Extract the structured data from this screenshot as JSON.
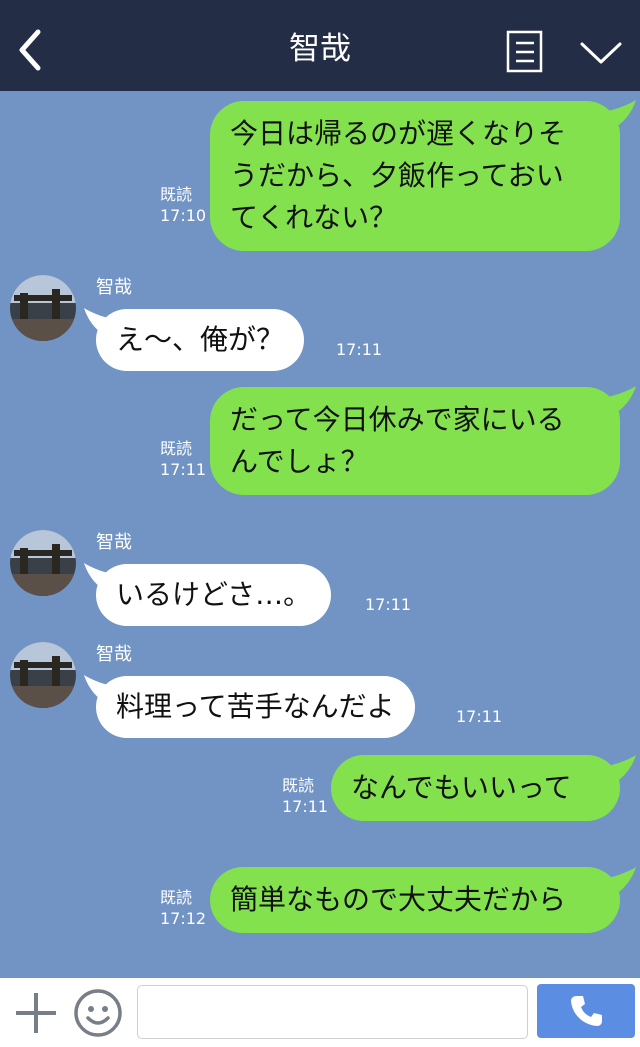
{
  "header": {
    "title": "智哉",
    "back_icon": "chevron-left-icon",
    "notes_icon": "notes-icon",
    "menu_icon": "chevron-down-icon",
    "background": "#232d45"
  },
  "chat": {
    "background": "#7194c4",
    "outgoing_color": "#84e14e",
    "incoming_color": "#ffffff",
    "messages": [
      {
        "side": "out",
        "lines": [
          "今日は帰るのが遅くなりそ",
          "うだから、夕飯作っておい",
          "てくれない？"
        ],
        "read": "既読",
        "time": "17:10"
      },
      {
        "side": "in",
        "sender": "智哉",
        "lines": [
          "え〜、俺が？"
        ],
        "time": "17:11"
      },
      {
        "side": "out",
        "lines": [
          "だって今日休みで家にいる",
          "んでしょ？"
        ],
        "read": "既読",
        "time": "17:11"
      },
      {
        "side": "in",
        "sender": "智哉",
        "lines": [
          "いるけどさ…。"
        ],
        "time": "17:11"
      },
      {
        "side": "in",
        "sender": "智哉",
        "lines": [
          "料理って苦手なんだよ"
        ],
        "time": "17:11"
      },
      {
        "side": "out",
        "lines": [
          "なんでもいいって"
        ],
        "read": "既読",
        "time": "17:11"
      },
      {
        "side": "out",
        "lines": [
          "簡単なもので大丈夫だから"
        ],
        "read": "既読",
        "time": "17:12"
      }
    ]
  },
  "input_bar": {
    "plus_icon": "plus-icon",
    "emoji_icon": "smiley-icon",
    "text_value": "",
    "call_icon": "phone-icon",
    "call_color": "#5b8ee3"
  }
}
